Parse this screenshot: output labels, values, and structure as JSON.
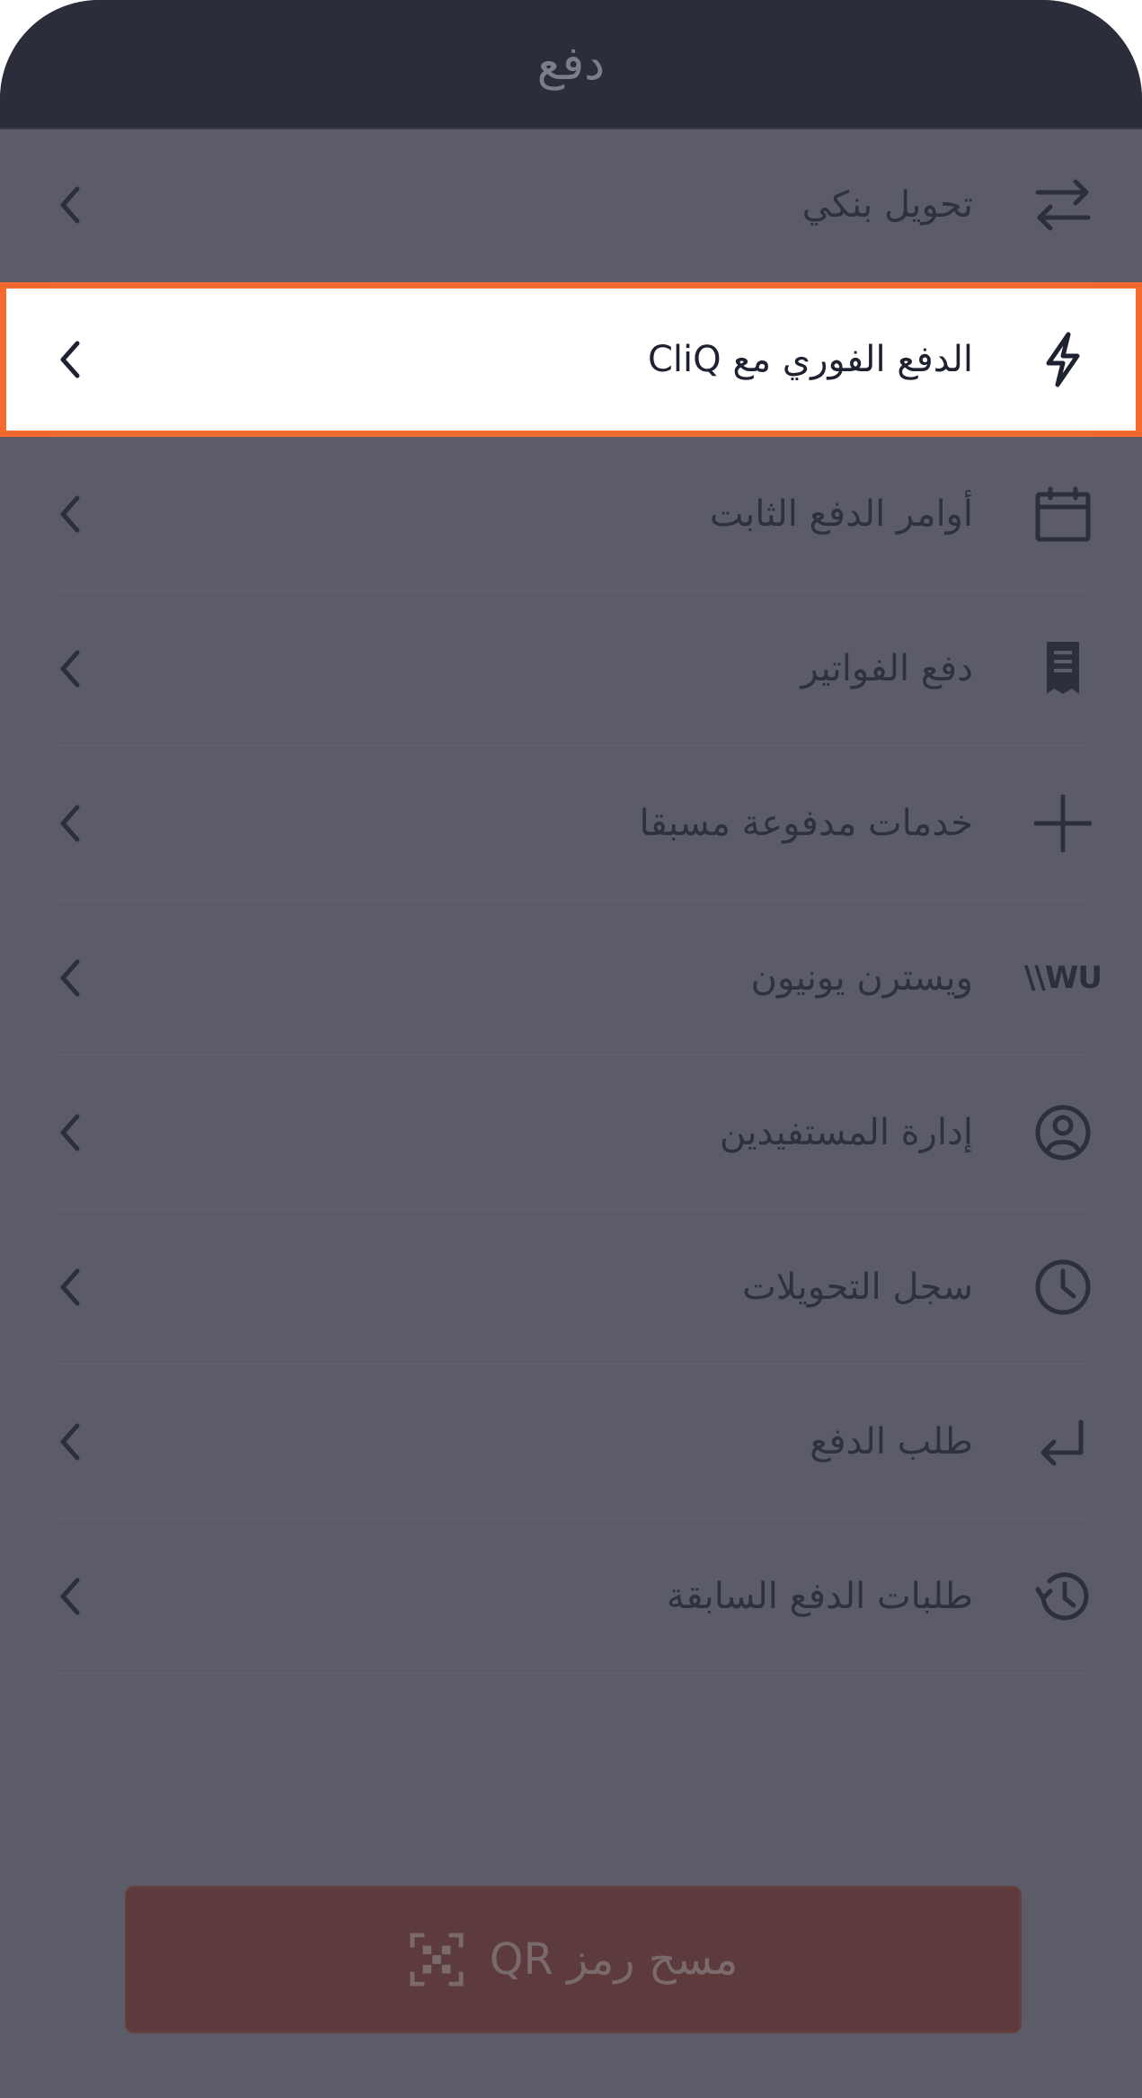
{
  "header": {
    "title": "دفع"
  },
  "menu": {
    "items": [
      {
        "label": "تحويل بنكي",
        "icon": "transfer-arrows-icon",
        "selected": false
      },
      {
        "label": "الدفع الفوري مع CliQ",
        "icon": "lightning-icon",
        "selected": true
      },
      {
        "label": "أوامر الدفع الثابت",
        "icon": "calendar-icon",
        "selected": false
      },
      {
        "label": "دفع الفواتير",
        "icon": "receipt-icon",
        "selected": false
      },
      {
        "label": "خدمات مدفوعة مسبقا",
        "icon": "plus-icon",
        "selected": false
      },
      {
        "label": "ويسترن يونيون",
        "icon": "western-union-logo-icon",
        "logo_text": "\\\\WU",
        "selected": false
      },
      {
        "label": "إدارة المستفيدين",
        "icon": "user-circle-icon",
        "selected": false
      },
      {
        "label": "سجل التحويلات",
        "icon": "clock-icon",
        "selected": false
      },
      {
        "label": "طلب الدفع",
        "icon": "return-arrow-icon",
        "selected": false
      },
      {
        "label": "طلبات الدفع السابقة",
        "icon": "history-icon",
        "selected": false
      }
    ]
  },
  "qr_button": {
    "label": "مسح رمز QR",
    "icon": "qr-scan-icon"
  },
  "colors": {
    "overlay_background": "#5c5c69",
    "header_background": "#2b2e3a",
    "highlight_border": "#f56a2f",
    "qr_button_background": "#5d3a3c"
  }
}
